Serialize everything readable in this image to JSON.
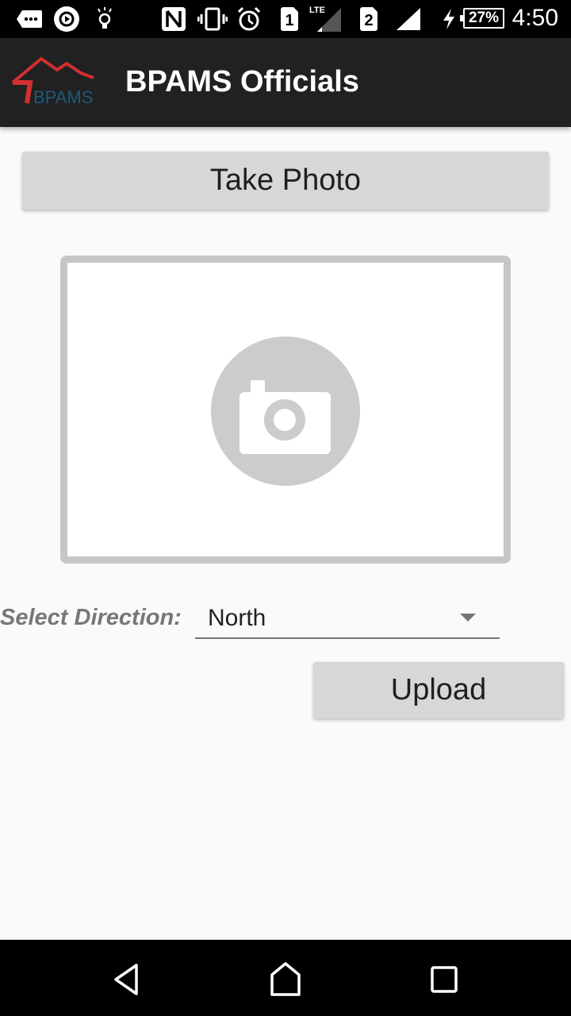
{
  "status_bar": {
    "icons": [
      "more-notifications-icon",
      "play-icon",
      "lightbulb-icon",
      "nfc-icon",
      "vibrate-icon",
      "alarm-icon",
      "sim1-icon",
      "lte-signal-icon",
      "sim2-icon",
      "signal-icon",
      "charging-icon",
      "battery-icon"
    ],
    "sim1_label": "1",
    "sim2_label": "2",
    "lte_label": "LTE",
    "battery_percent": "27%",
    "time": "4:50"
  },
  "app_bar": {
    "logo_text": "BPAMS",
    "title": "BPAMS Officials",
    "logo_colors": {
      "roof": "#d32f2f",
      "text": "#1e5a78"
    }
  },
  "main": {
    "take_photo_label": "Take Photo",
    "photo_placeholder_icon": "camera-icon",
    "direction_label": "Select Direction:",
    "direction_value": "North",
    "upload_label": "Upload"
  },
  "nav_bar": {
    "back_icon": "back-icon",
    "home_icon": "home-icon",
    "recents_icon": "recents-icon"
  }
}
